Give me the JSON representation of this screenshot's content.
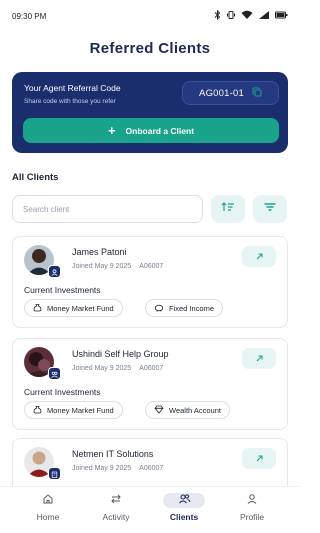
{
  "status_bar": {
    "time": "09:30 PM"
  },
  "page_title": "Referred Clients",
  "referral": {
    "title": "Your Agent Referral Code",
    "subtitle": "Share code with those you refer",
    "code": "AG001-01",
    "onboard_label": "Onboard a Client"
  },
  "clients_section": {
    "title": "All Clients",
    "search_placeholder": "Search client"
  },
  "investments_heading": "Current Investments",
  "clients": [
    {
      "name": "James Patoni",
      "joined": "Joined May 9 2025",
      "code": "A06007",
      "investments": [
        "Money Market Fund",
        "Fixed Income"
      ]
    },
    {
      "name": "Ushindi Self Help Group",
      "joined": "Joined May 9 2025",
      "code": "A06007",
      "investments": [
        "Money Market Fund",
        "Wealth Account"
      ]
    },
    {
      "name": "Netmen IT Solutions",
      "joined": "Joined May 9 2025",
      "code": "A06007",
      "investments": []
    }
  ],
  "nav": {
    "items": [
      {
        "label": "Home"
      },
      {
        "label": "Activity"
      },
      {
        "label": "Clients"
      },
      {
        "label": "Profile"
      }
    ],
    "active": "Clients"
  },
  "colors": {
    "brand_navy": "#1a2d6d",
    "accent_teal": "#1aa38b",
    "title": "#1b2a57"
  }
}
